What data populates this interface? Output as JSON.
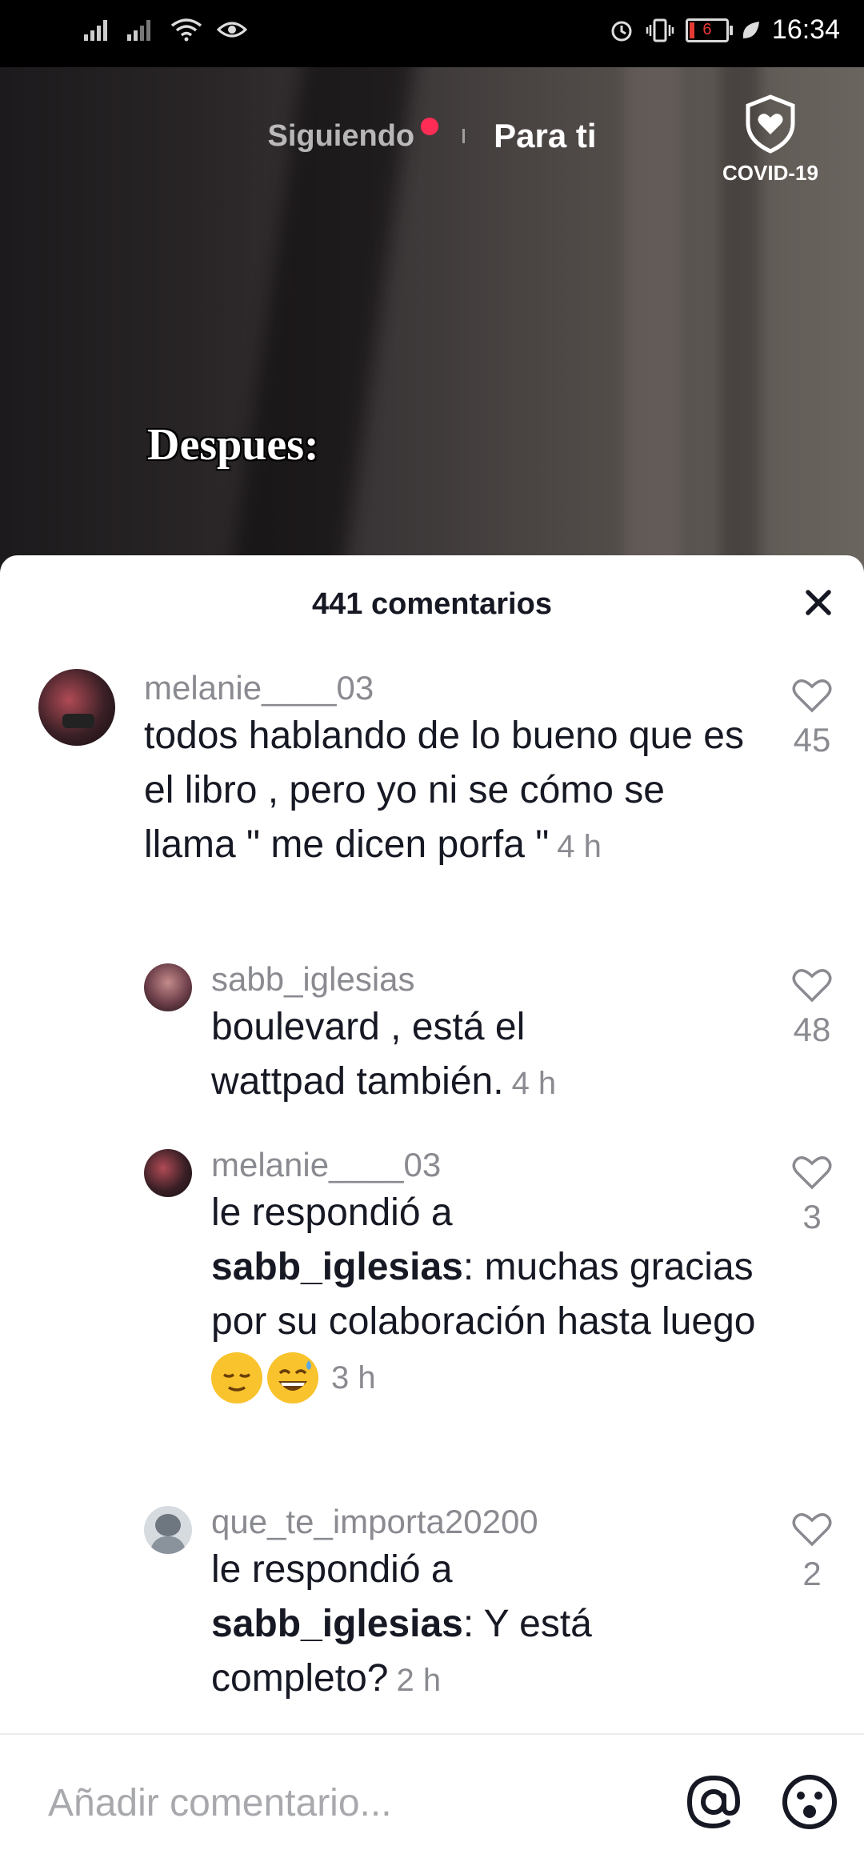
{
  "status_bar": {
    "time": "16:34",
    "battery_level": "6",
    "icons": [
      "signal-icon",
      "signal-icon",
      "wifi-icon",
      "eye-icon",
      "alarm-icon",
      "vibrate-icon",
      "battery-icon",
      "leaf-icon"
    ]
  },
  "feed": {
    "tab_following": "Siguiendo",
    "tab_for_you": "Para ti",
    "covid_label": "COVID-19",
    "video_caption": "Despues:"
  },
  "comments_sheet": {
    "title": "441 comentarios",
    "comments": [
      {
        "user": "melanie____03",
        "text": "todos hablando de lo bueno que es el libro , pero yo ni se cómo se llama \" me dicen porfa \"",
        "time": "4 h",
        "likes": "45"
      },
      {
        "user": "sabb_iglesias",
        "text": "boulevard , está el wattpad también.",
        "time": "4 h",
        "likes": "48"
      },
      {
        "user": "melanie____03",
        "reply_prefix": "le respondió a",
        "reply_to": "sabb_iglesias",
        "text": ": muchas gracias por su colaboración hasta luego",
        "time": "3 h",
        "likes": "3"
      },
      {
        "user": "que_te_importa20200",
        "reply_prefix": "le respondió a",
        "reply_to": "sabb_iglesias",
        "text": ": Y está completo?",
        "time": "2 h",
        "likes": "2"
      }
    ]
  },
  "input_bar": {
    "placeholder": "Añadir comentario..."
  },
  "colors": {
    "accent": "#ff2c55",
    "text_primary": "#161823",
    "text_secondary": "#8a8b91"
  }
}
